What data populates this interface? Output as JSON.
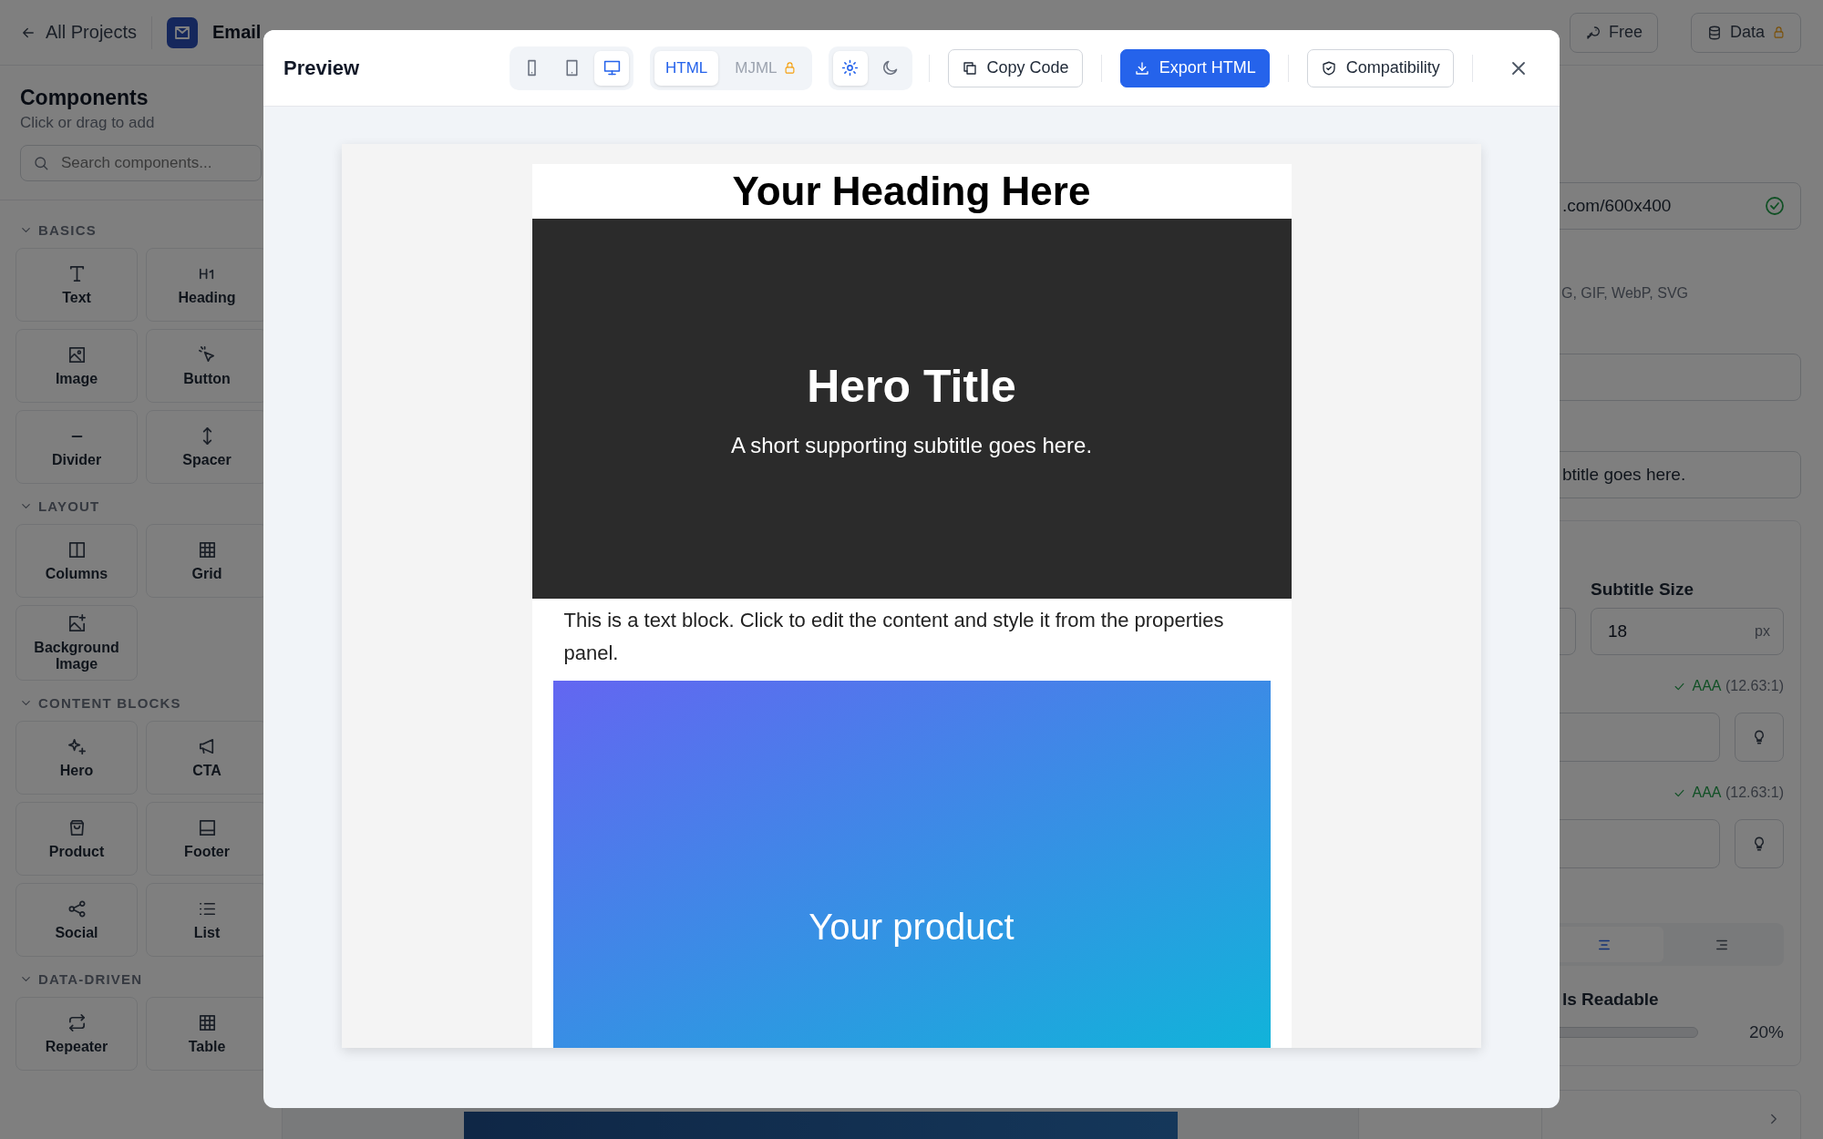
{
  "topbar": {
    "back_link": "All Projects",
    "app_name": "Email",
    "buttons": [
      {
        "label": "Free",
        "locked": false
      },
      {
        "label": "Data",
        "locked": true
      }
    ]
  },
  "sidebar": {
    "title": "Components",
    "subtitle": "Click or drag to add",
    "search": {
      "placeholder": "Search components..."
    },
    "sections": [
      {
        "title": "BASICS",
        "expanded": true,
        "items": [
          "Text",
          "Heading",
          "Image",
          "Button",
          "Divider",
          "Spacer"
        ]
      },
      {
        "title": "LAYOUT",
        "expanded": true,
        "items": [
          "Columns",
          "Grid",
          "Background Image"
        ]
      },
      {
        "title": "CONTENT BLOCKS",
        "expanded": true,
        "items": [
          "Hero",
          "CTA",
          "Product",
          "Footer",
          "Social",
          "List"
        ]
      },
      {
        "title": "DATA-DRIVEN",
        "expanded": true,
        "items": [
          "Repeater",
          "Table"
        ]
      }
    ]
  },
  "properties_panel": {
    "image_url": {
      "value": ".com/600x400",
      "valid": true
    },
    "formats_hint": "G, GIF, WebP, SVG",
    "subtitle_field": {
      "value": "btitle goes here."
    },
    "subtitle_size": {
      "label": "Subtitle Size",
      "value": "18",
      "unit": "px"
    },
    "contrast_checks": [
      {
        "pass": true,
        "grade": "AAA",
        "ratio": "(12.63:1)"
      },
      {
        "pass": true,
        "grade": "AAA",
        "ratio": "(12.63:1)"
      }
    ],
    "alignment": [
      {
        "kind": "center",
        "selected": true
      },
      {
        "kind": "right",
        "selected": false
      }
    ],
    "slider": {
      "label": "ls Readable",
      "reading": "20%"
    }
  },
  "preview_modal": {
    "title": "Preview",
    "devices": [
      {
        "kind": "phone",
        "selected": false
      },
      {
        "kind": "tablet",
        "selected": false
      },
      {
        "kind": "desktop",
        "selected": true
      }
    ],
    "formats": [
      {
        "label": "HTML",
        "selected": true,
        "locked": false
      },
      {
        "label": "MJML",
        "selected": false,
        "locked": true
      }
    ],
    "themes": [
      {
        "kind": "light",
        "selected": true
      },
      {
        "kind": "dark",
        "selected": false
      }
    ],
    "buttons": [
      {
        "kind": "copy",
        "label": "Copy Code",
        "primary": false
      },
      {
        "kind": "export",
        "label": "Export HTML",
        "primary": true
      },
      {
        "kind": "compat",
        "label": "Compatibility",
        "primary": false
      }
    ],
    "email": {
      "heading": "Your Heading Here",
      "hero_title": "Hero Title",
      "hero_subtitle": "A short supporting subtitle goes here.",
      "text_block": "This is a text block. Click to edit the content and style it from the properties panel.",
      "product_label": "Your product"
    }
  }
}
